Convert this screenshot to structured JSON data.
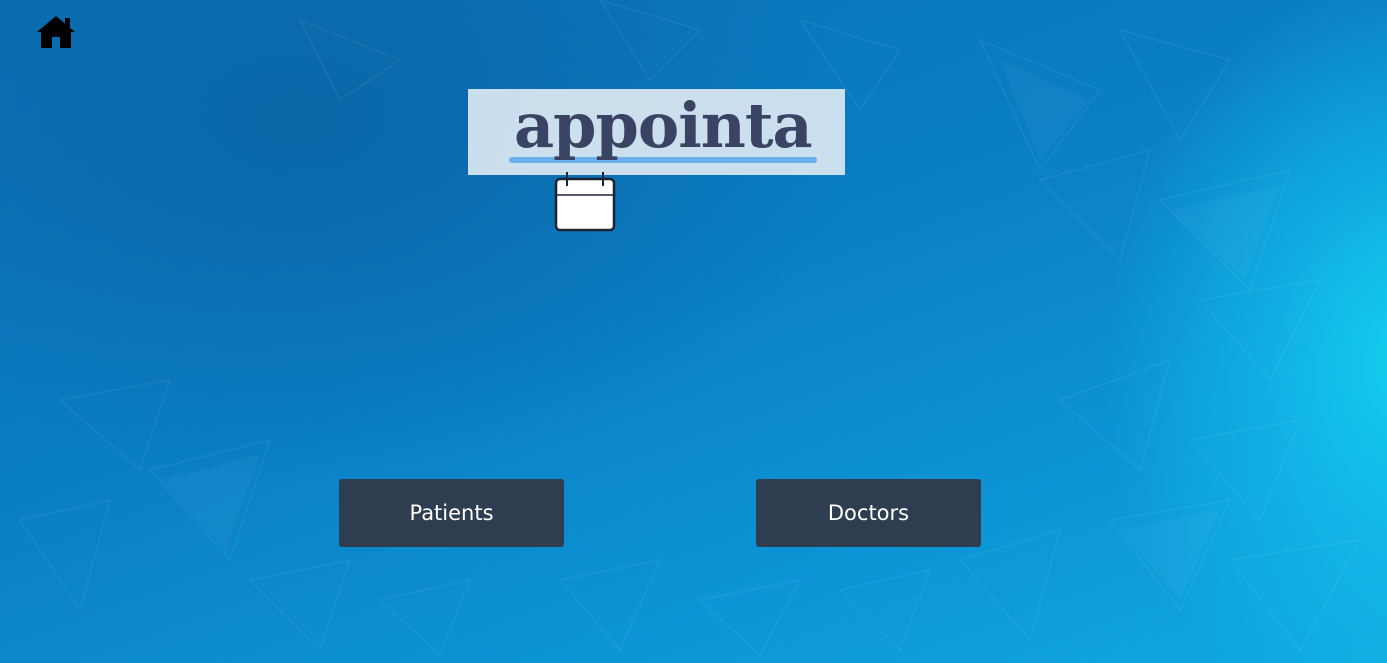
{
  "header": {
    "home_icon": "home-icon"
  },
  "logo": {
    "text": "appointa",
    "icon": "calendar-icon",
    "text_color": "#3a4363",
    "underline_color": "#6aaeea"
  },
  "actions": {
    "patients_label": "Patients",
    "doctors_label": "Doctors"
  },
  "colors": {
    "button_bg": "#2f3d51",
    "button_text": "#ffffff",
    "background_primary": "#0a7fc4",
    "background_glow": "#14d2f0"
  }
}
